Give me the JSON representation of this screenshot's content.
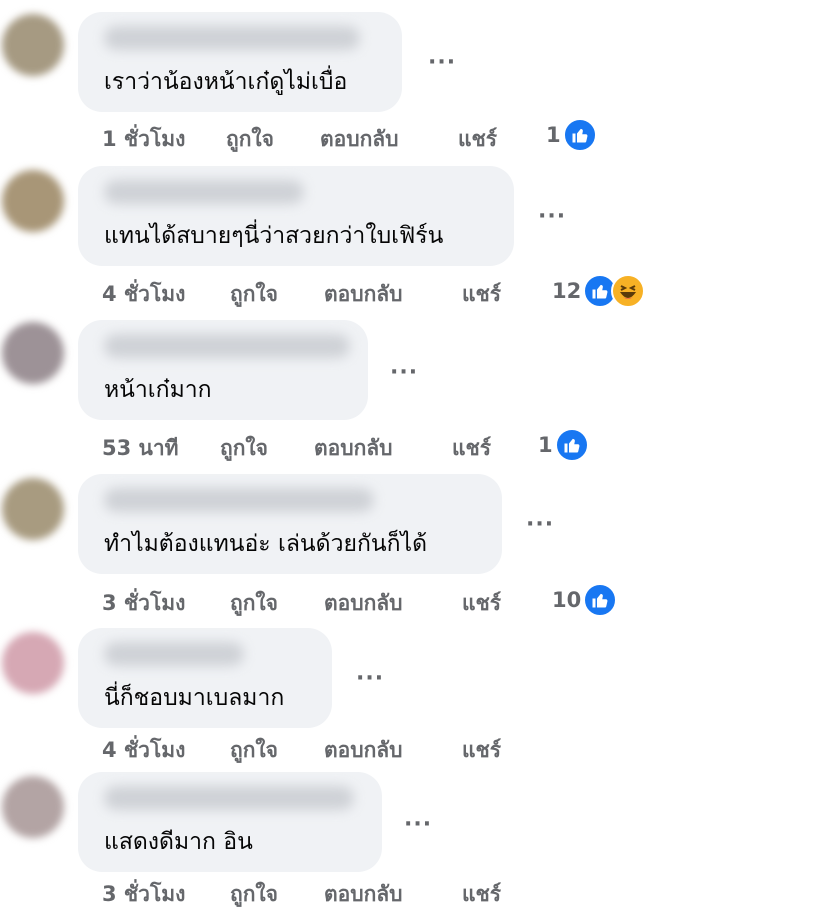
{
  "comments": [
    {
      "text": "เราว่าน้องหน้าเก๋ดูไม่เบื่อ",
      "time": "1 ชั่วโมง",
      "like": "ถูกใจ",
      "reply": "ตอบกลับ",
      "share": "แชร์",
      "reactions": "1",
      "reaction_icons": [
        "like-icon"
      ],
      "avatar_color": "#a69a82"
    },
    {
      "text": "แทนได้สบายๆนี่ว่าสวยกว่าใบเฟิร์น",
      "time": "4 ชั่วโมง",
      "like": "ถูกใจ",
      "reply": "ตอบกลับ",
      "share": "แชร์",
      "reactions": "12",
      "reaction_icons": [
        "like-icon",
        "haha-icon"
      ],
      "avatar_color": "#a89677"
    },
    {
      "text": "หน้าเก๋มาก",
      "time": "53 นาที",
      "like": "ถูกใจ",
      "reply": "ตอบกลับ",
      "share": "แชร์",
      "reactions": "1",
      "reaction_icons": [
        "like-icon"
      ],
      "avatar_color": "#9d9297"
    },
    {
      "text": "ทำไมต้องแทนอ่ะ เล่นด้วยกันก็ได้",
      "time": "3 ชั่วโมง",
      "like": "ถูกใจ",
      "reply": "ตอบกลับ",
      "share": "แชร์",
      "reactions": "10",
      "reaction_icons": [
        "like-icon"
      ],
      "avatar_color": "#a89b80"
    },
    {
      "text": "นี่ก็ชอบมาเบลมาก",
      "time": "4 ชั่วโมง",
      "like": "ถูกใจ",
      "reply": "ตอบกลับ",
      "share": "แชร์",
      "reactions": "",
      "reaction_icons": [],
      "avatar_color": "#d6a8b4"
    },
    {
      "text": "แสดงดีมาก อิน",
      "time": "3 ชั่วโมง",
      "like": "ถูกใจ",
      "reply": "ตอบกลับ",
      "share": "แชร์",
      "reactions": "",
      "reaction_icons": [],
      "avatar_color": "#b3a4a4"
    }
  ],
  "more_glyph": "···"
}
